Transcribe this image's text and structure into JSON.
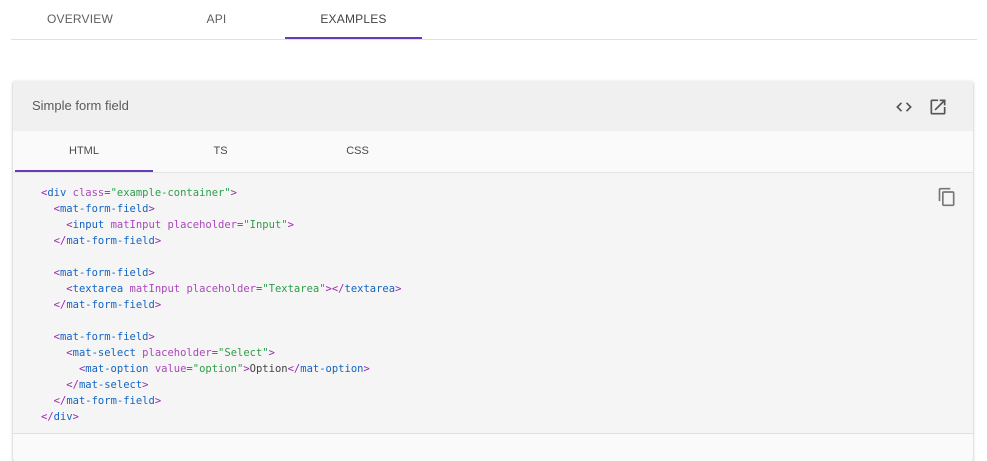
{
  "top_tabs": [
    {
      "label": "OVERVIEW"
    },
    {
      "label": "API"
    },
    {
      "label": "EXAMPLES"
    }
  ],
  "example": {
    "title": "Simple form field",
    "actions": {
      "view_source_icon": "code-brackets-icon",
      "open_icon": "open-in-new-icon",
      "copy_icon": "copy-icon"
    },
    "source_tabs": [
      {
        "label": "HTML"
      },
      {
        "label": "TS"
      },
      {
        "label": "CSS"
      }
    ],
    "active_source_tab": "HTML",
    "code_lines": [
      [
        {
          "t": "punc",
          "v": "<"
        },
        {
          "t": "tag",
          "v": "div"
        },
        {
          "t": "txt",
          "v": " "
        },
        {
          "t": "attr",
          "v": "class"
        },
        {
          "t": "punc",
          "v": "="
        },
        {
          "t": "str",
          "v": "\"example-container\""
        },
        {
          "t": "punc",
          "v": ">"
        }
      ],
      [
        {
          "t": "txt",
          "v": "  "
        },
        {
          "t": "punc",
          "v": "<"
        },
        {
          "t": "tag",
          "v": "mat-form-field"
        },
        {
          "t": "punc",
          "v": ">"
        }
      ],
      [
        {
          "t": "txt",
          "v": "    "
        },
        {
          "t": "punc",
          "v": "<"
        },
        {
          "t": "tag",
          "v": "input"
        },
        {
          "t": "txt",
          "v": " "
        },
        {
          "t": "attr",
          "v": "matInput"
        },
        {
          "t": "txt",
          "v": " "
        },
        {
          "t": "attr",
          "v": "placeholder"
        },
        {
          "t": "punc",
          "v": "="
        },
        {
          "t": "str",
          "v": "\"Input\""
        },
        {
          "t": "punc",
          "v": ">"
        }
      ],
      [
        {
          "t": "txt",
          "v": "  "
        },
        {
          "t": "punc",
          "v": "</"
        },
        {
          "t": "tag",
          "v": "mat-form-field"
        },
        {
          "t": "punc",
          "v": ">"
        }
      ],
      [],
      [
        {
          "t": "txt",
          "v": "  "
        },
        {
          "t": "punc",
          "v": "<"
        },
        {
          "t": "tag",
          "v": "mat-form-field"
        },
        {
          "t": "punc",
          "v": ">"
        }
      ],
      [
        {
          "t": "txt",
          "v": "    "
        },
        {
          "t": "punc",
          "v": "<"
        },
        {
          "t": "tag",
          "v": "textarea"
        },
        {
          "t": "txt",
          "v": " "
        },
        {
          "t": "attr",
          "v": "matInput"
        },
        {
          "t": "txt",
          "v": " "
        },
        {
          "t": "attr",
          "v": "placeholder"
        },
        {
          "t": "punc",
          "v": "="
        },
        {
          "t": "str",
          "v": "\"Textarea\""
        },
        {
          "t": "punc",
          "v": "></"
        },
        {
          "t": "tag",
          "v": "textarea"
        },
        {
          "t": "punc",
          "v": ">"
        }
      ],
      [
        {
          "t": "txt",
          "v": "  "
        },
        {
          "t": "punc",
          "v": "</"
        },
        {
          "t": "tag",
          "v": "mat-form-field"
        },
        {
          "t": "punc",
          "v": ">"
        }
      ],
      [],
      [
        {
          "t": "txt",
          "v": "  "
        },
        {
          "t": "punc",
          "v": "<"
        },
        {
          "t": "tag",
          "v": "mat-form-field"
        },
        {
          "t": "punc",
          "v": ">"
        }
      ],
      [
        {
          "t": "txt",
          "v": "    "
        },
        {
          "t": "punc",
          "v": "<"
        },
        {
          "t": "tag",
          "v": "mat-select"
        },
        {
          "t": "txt",
          "v": " "
        },
        {
          "t": "attr",
          "v": "placeholder"
        },
        {
          "t": "punc",
          "v": "="
        },
        {
          "t": "str",
          "v": "\"Select\""
        },
        {
          "t": "punc",
          "v": ">"
        }
      ],
      [
        {
          "t": "txt",
          "v": "      "
        },
        {
          "t": "punc",
          "v": "<"
        },
        {
          "t": "tag",
          "v": "mat-option"
        },
        {
          "t": "txt",
          "v": " "
        },
        {
          "t": "attr",
          "v": "value"
        },
        {
          "t": "punc",
          "v": "="
        },
        {
          "t": "str",
          "v": "\"option\""
        },
        {
          "t": "punc",
          "v": ">"
        },
        {
          "t": "txt",
          "v": "Option"
        },
        {
          "t": "punc",
          "v": "</"
        },
        {
          "t": "tag",
          "v": "mat-option"
        },
        {
          "t": "punc",
          "v": ">"
        }
      ],
      [
        {
          "t": "txt",
          "v": "    "
        },
        {
          "t": "punc",
          "v": "</"
        },
        {
          "t": "tag",
          "v": "mat-select"
        },
        {
          "t": "punc",
          "v": ">"
        }
      ],
      [
        {
          "t": "txt",
          "v": "  "
        },
        {
          "t": "punc",
          "v": "</"
        },
        {
          "t": "tag",
          "v": "mat-form-field"
        },
        {
          "t": "punc",
          "v": ">"
        }
      ],
      [
        {
          "t": "punc",
          "v": "</"
        },
        {
          "t": "tag",
          "v": "div"
        },
        {
          "t": "punc",
          "v": ">"
        }
      ]
    ]
  },
  "colors": {
    "accent": "#673ab7",
    "tag": "#1565c0",
    "attribute": "#ab47bc",
    "string": "#2e9d4a"
  }
}
